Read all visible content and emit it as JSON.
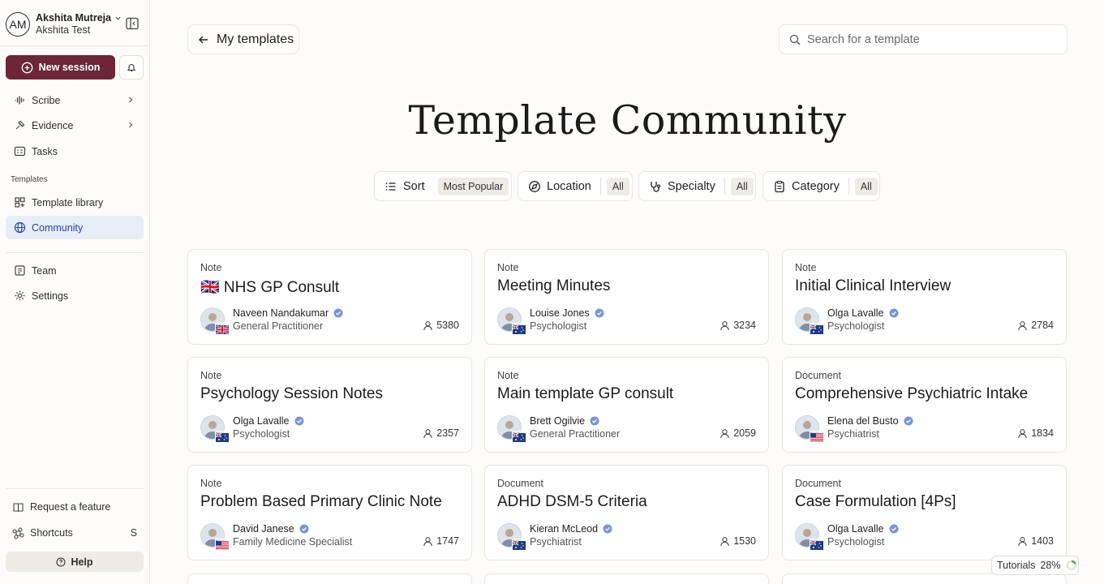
{
  "user": {
    "initials": "AM",
    "name": "Akshita Mutreja",
    "org": "Akshita Test"
  },
  "actions": {
    "new_session": "New session"
  },
  "nav": {
    "scribe": "Scribe",
    "evidence": "Evidence",
    "tasks": "Tasks",
    "templates_section": "Templates",
    "template_library": "Template library",
    "community": "Community",
    "team": "Team",
    "settings": "Settings"
  },
  "bottom": {
    "request_feature": "Request a feature",
    "shortcuts": "Shortcuts",
    "shortcuts_key": "S",
    "help": "Help"
  },
  "header": {
    "back_label": "My templates",
    "search_placeholder": "Search for a template"
  },
  "page_title": "Template Community",
  "filters": {
    "sort": {
      "label": "Sort",
      "value": "Most Popular"
    },
    "location": {
      "label": "Location",
      "value": "All"
    },
    "specialty": {
      "label": "Specialty",
      "value": "All"
    },
    "category": {
      "label": "Category",
      "value": "All"
    }
  },
  "cards": [
    {
      "type": "Note",
      "title": "🇬🇧 NHS GP Consult",
      "author": "Naveen Nandakumar",
      "role": "General Practitioner",
      "uses": "5380",
      "flag": "uk"
    },
    {
      "type": "Note",
      "title": "Meeting Minutes",
      "author": "Louise Jones",
      "role": "Psychologist",
      "uses": "3234",
      "flag": "au"
    },
    {
      "type": "Note",
      "title": "Initial Clinical Interview",
      "author": "Olga Lavalle",
      "role": "Psychologist",
      "uses": "2784",
      "flag": "au"
    },
    {
      "type": "Note",
      "title": "Psychology Session Notes",
      "author": "Olga Lavalle",
      "role": "Psychologist",
      "uses": "2357",
      "flag": "au"
    },
    {
      "type": "Note",
      "title": "Main template GP consult",
      "author": "Brett Ogilvie",
      "role": "General Practitioner",
      "uses": "2059",
      "flag": "au"
    },
    {
      "type": "Document",
      "title": "Comprehensive Psychiatric Intake",
      "author": "Elena del Busto",
      "role": "Psychiatrist",
      "uses": "1834",
      "flag": "us"
    },
    {
      "type": "Note",
      "title": "Problem Based Primary Clinic Note",
      "author": "David Janese",
      "role": "Family Medicine Specialist",
      "uses": "1747",
      "flag": "us"
    },
    {
      "type": "Document",
      "title": "ADHD DSM-5 Criteria",
      "author": "Kieran McLeod",
      "role": "Psychiatrist",
      "uses": "1530",
      "flag": "au"
    },
    {
      "type": "Document",
      "title": "Case Formulation [4Ps]",
      "author": "Olga Lavalle",
      "role": "Psychologist",
      "uses": "1403",
      "flag": "au"
    }
  ],
  "tutorials": {
    "label": "Tutorials",
    "progress": "28%"
  },
  "colors": {
    "brand": "#6b2638",
    "active_nav_bg": "#e8eef8",
    "active_nav_text": "#24469b",
    "verified": "#6b84c9"
  }
}
